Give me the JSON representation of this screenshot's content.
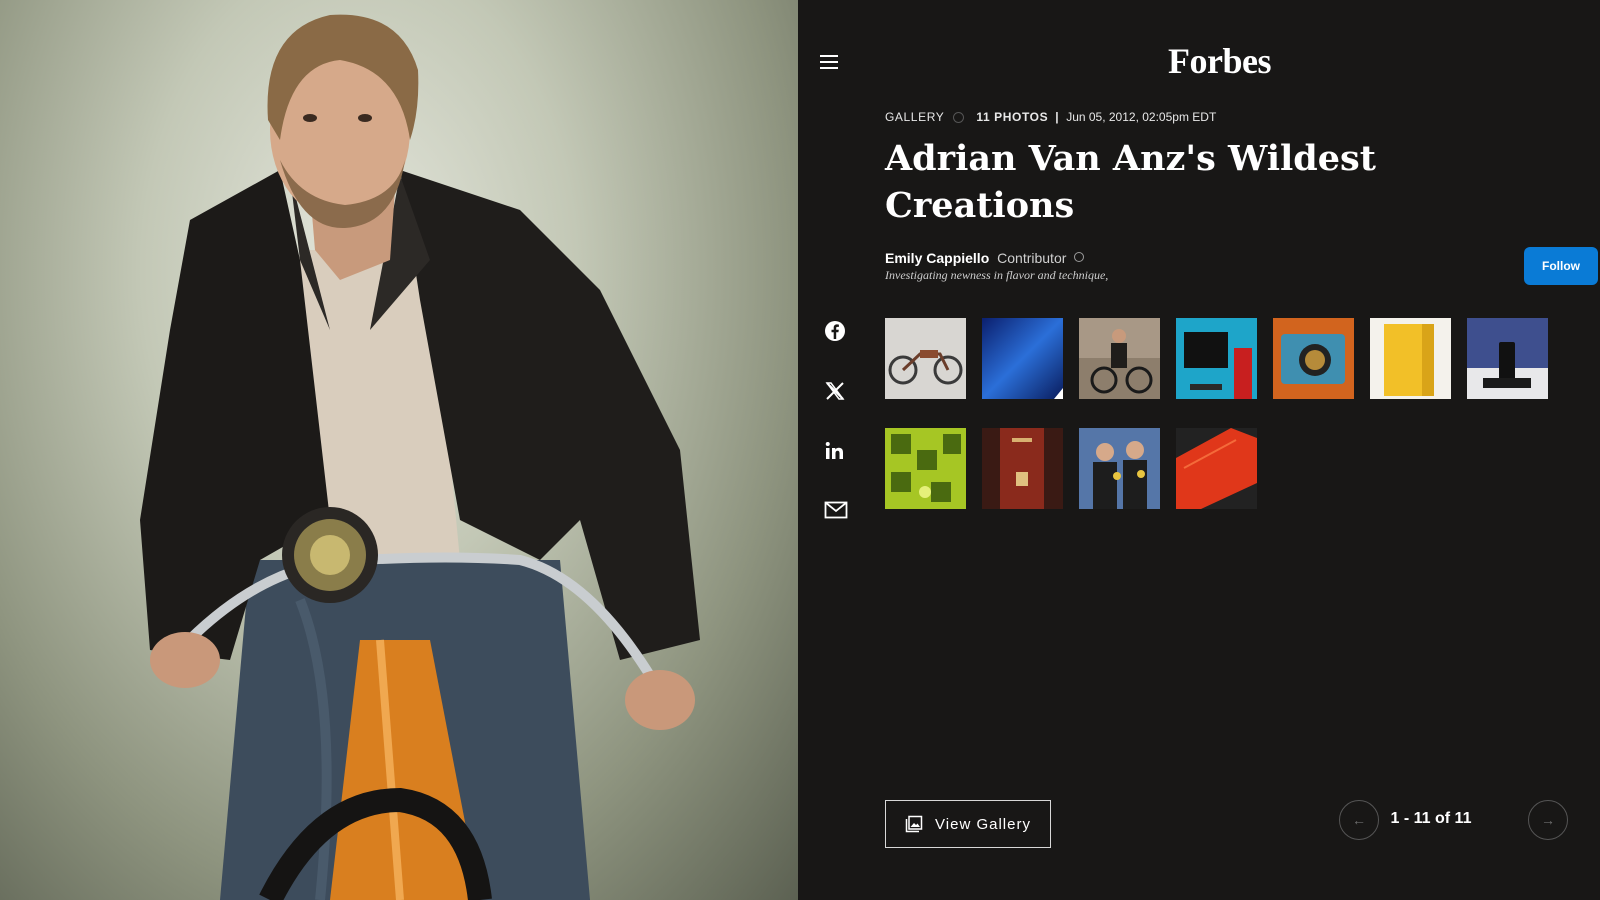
{
  "header": {
    "logo": "Forbes",
    "menu_icon": "hamburger-menu-icon"
  },
  "article": {
    "kind": "GALLERY",
    "photo_count": "11 PHOTOS",
    "separator": "|",
    "date": "Jun 05, 2012, 02:05pm EDT",
    "title": "Adrian Van Anz's Wildest Creations"
  },
  "author": {
    "name": "Emily Cappiello",
    "role": "Contributor",
    "tagline": "Investigating newness in flavor and technique,",
    "follow_label": "Follow"
  },
  "share": {
    "items": [
      {
        "icon": "facebook-icon"
      },
      {
        "icon": "x-twitter-icon"
      },
      {
        "icon": "linkedin-icon"
      },
      {
        "icon": "email-icon"
      }
    ]
  },
  "gallery": {
    "thumbnails": [
      {
        "subject": "motorized bicycle"
      },
      {
        "subject": "blue surface"
      },
      {
        "subject": "man on bicycle"
      },
      {
        "subject": "red computer tower and monitor"
      },
      {
        "subject": "blue digital camera"
      },
      {
        "subject": "yellow device"
      },
      {
        "subject": "HP media player"
      },
      {
        "subject": "green 2 pattern"
      },
      {
        "subject": "red tower case"
      },
      {
        "subject": "two men with medals"
      },
      {
        "subject": "red console"
      }
    ],
    "view_gallery_label": "View Gallery",
    "pager": {
      "range": "1 - 11 of 11",
      "prev_icon": "arrow-left-icon",
      "next_icon": "arrow-right-icon"
    }
  },
  "colors": {
    "panel_bg": "#181716",
    "follow_button": "#0a7bd6",
    "text": "#ffffff"
  }
}
